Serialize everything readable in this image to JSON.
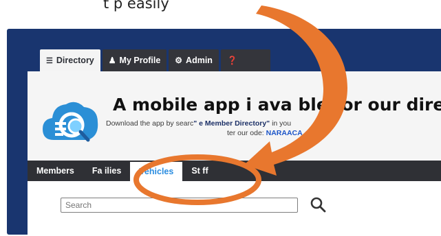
{
  "caption": "t     p     easily     ",
  "top_tabs": [
    {
      "icon": "list-icon",
      "label": "Directory",
      "active": true
    },
    {
      "icon": "user-icon",
      "label": "My Profile",
      "active": false
    },
    {
      "icon": "gear-icon",
      "label": "Admin",
      "active": false
    },
    {
      "icon": "help-icon",
      "label": "",
      "active": false
    }
  ],
  "banner": {
    "title": "A mobile app i  ava  ble for our dire",
    "line1_start": "Download the app by searc",
    "line1_mid": "\"         e Member Directory\"",
    "line1_end": " in you",
    "line2_start": "ter our",
    "line2_mid": "         ode: ",
    "code": "NARAACA"
  },
  "sub_tabs": [
    {
      "label": "Members",
      "active": false
    },
    {
      "label": "Fa    ilies",
      "active": false
    },
    {
      "label": "Vehicles",
      "active": true
    },
    {
      "label": "St  ff",
      "active": false
    }
  ],
  "search": {
    "placeholder": "Search"
  },
  "colors": {
    "frame": "#19356f",
    "tab_dark": "#34353b",
    "active_tab": "#2b8de0",
    "code_blue": "#1c55c8",
    "annotation_orange": "#e8772e"
  }
}
